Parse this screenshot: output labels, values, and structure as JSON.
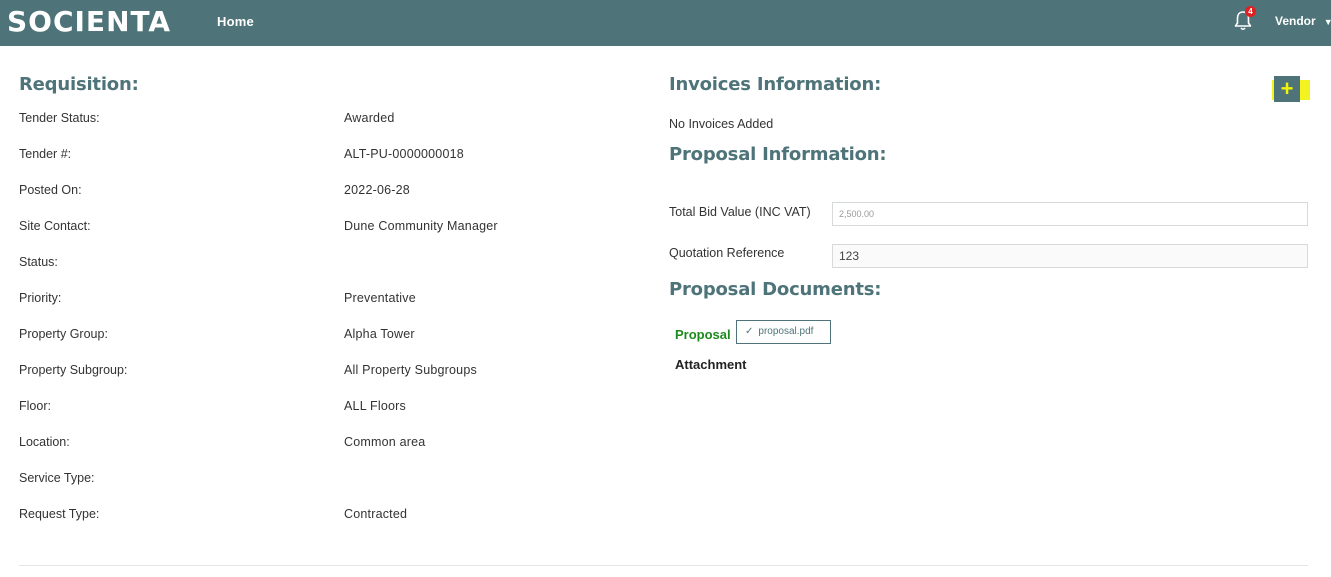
{
  "header": {
    "logo": "SOCIENTA",
    "nav_home": "Home",
    "notification_count": "4",
    "user_label": "Vendor",
    "colors": {
      "bar": "#4e7479",
      "badge": "#e02020"
    }
  },
  "requisition": {
    "title": "Requisition:",
    "rows": [
      {
        "label": "Tender Status:",
        "value": "Awarded"
      },
      {
        "label": "Tender #:",
        "value": "ALT-PU-0000000018"
      },
      {
        "label": "Posted On:",
        "value": "2022-06-28"
      },
      {
        "label": "Site Contact:",
        "value": "Dune Community Manager"
      },
      {
        "label": "Status:",
        "value": ""
      },
      {
        "label": "Priority:",
        "value": "Preventative"
      },
      {
        "label": "Property Group:",
        "value": "Alpha Tower"
      },
      {
        "label": "Property Subgroup:",
        "value": "All Property Subgroups"
      },
      {
        "label": "Floor:",
        "value": "ALL Floors"
      },
      {
        "label": "Location:",
        "value": "Common area"
      },
      {
        "label": "Service Type:",
        "value": ""
      },
      {
        "label": "Request Type:",
        "value": "Contracted"
      }
    ]
  },
  "invoices": {
    "title": "Invoices Information:",
    "empty_text": "No Invoices Added",
    "add_icon": "plus-icon"
  },
  "proposal": {
    "title": "Proposal Information:",
    "bid_label": "Total Bid Value (INC VAT)",
    "bid_value": "2,500.00",
    "quote_label": "Quotation Reference",
    "quote_value": "123"
  },
  "documents": {
    "title": "Proposal Documents:",
    "proposal_label": "Proposal",
    "proposal_file": "proposal.pdf",
    "attachment_label": "Attachment",
    "colors": {
      "proposal_label": "#1e8a1e"
    }
  }
}
